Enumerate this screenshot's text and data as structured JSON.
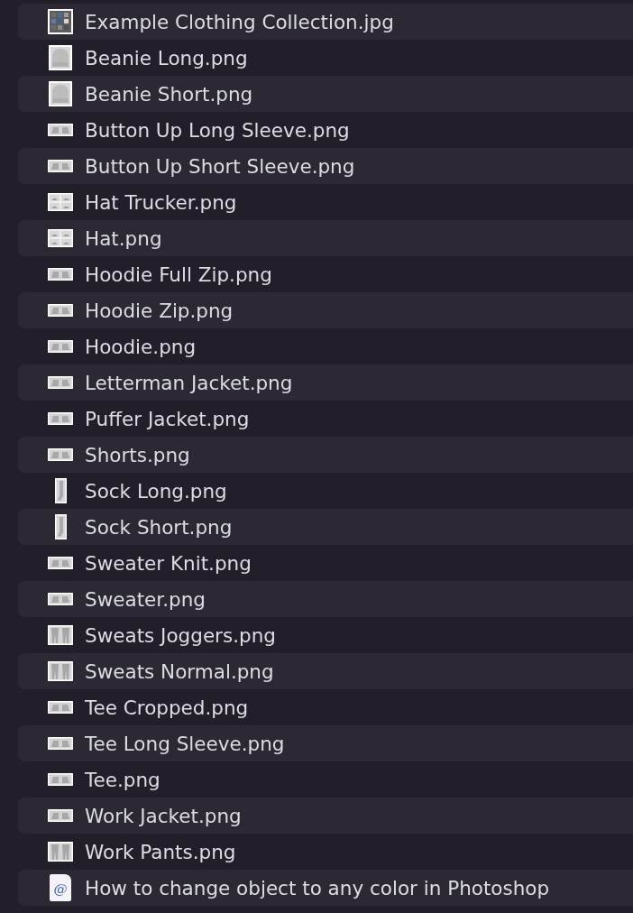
{
  "files": [
    {
      "name": "Example Clothing Collection.jpg",
      "kind": "collage",
      "selected": false
    },
    {
      "name": "Beanie Long.png",
      "kind": "square",
      "selected": false
    },
    {
      "name": "Beanie Short.png",
      "kind": "square",
      "selected": false
    },
    {
      "name": "Button Up Long Sleeve.png",
      "kind": "wide",
      "selected": false
    },
    {
      "name": "Button Up Short Sleeve.png",
      "kind": "wide",
      "selected": false
    },
    {
      "name": "Hat Trucker.png",
      "kind": "panel",
      "selected": false
    },
    {
      "name": "Hat.png",
      "kind": "panel",
      "selected": false
    },
    {
      "name": "Hoodie Full Zip.png",
      "kind": "wide",
      "selected": false
    },
    {
      "name": "Hoodie Zip.png",
      "kind": "wide",
      "selected": false
    },
    {
      "name": "Hoodie.png",
      "kind": "wide",
      "selected": false
    },
    {
      "name": "Letterman Jacket.png",
      "kind": "wide",
      "selected": false
    },
    {
      "name": "Puffer Jacket.png",
      "kind": "wide",
      "selected": false
    },
    {
      "name": "Shorts.png",
      "kind": "wide",
      "selected": false
    },
    {
      "name": "Sock Long.png",
      "kind": "tall",
      "selected": false
    },
    {
      "name": "Sock Short.png",
      "kind": "tall",
      "selected": false
    },
    {
      "name": "Sweater Knit.png",
      "kind": "wide",
      "selected": false
    },
    {
      "name": "Sweater.png",
      "kind": "wide",
      "selected": false
    },
    {
      "name": "Sweats Joggers.png",
      "kind": "block",
      "selected": false
    },
    {
      "name": "Sweats Normal.png",
      "kind": "block",
      "selected": false
    },
    {
      "name": "Tee Cropped.png",
      "kind": "wide",
      "selected": false
    },
    {
      "name": "Tee Long Sleeve.png",
      "kind": "wide",
      "selected": false
    },
    {
      "name": "Tee.png",
      "kind": "wide",
      "selected": false
    },
    {
      "name": "Work Jacket.png",
      "kind": "wide",
      "selected": false
    },
    {
      "name": "Work Pants.png",
      "kind": "block",
      "selected": false
    },
    {
      "name": "How to change object to any color in Photoshop",
      "kind": "weblink",
      "glyph": "@",
      "selected": false
    }
  ]
}
